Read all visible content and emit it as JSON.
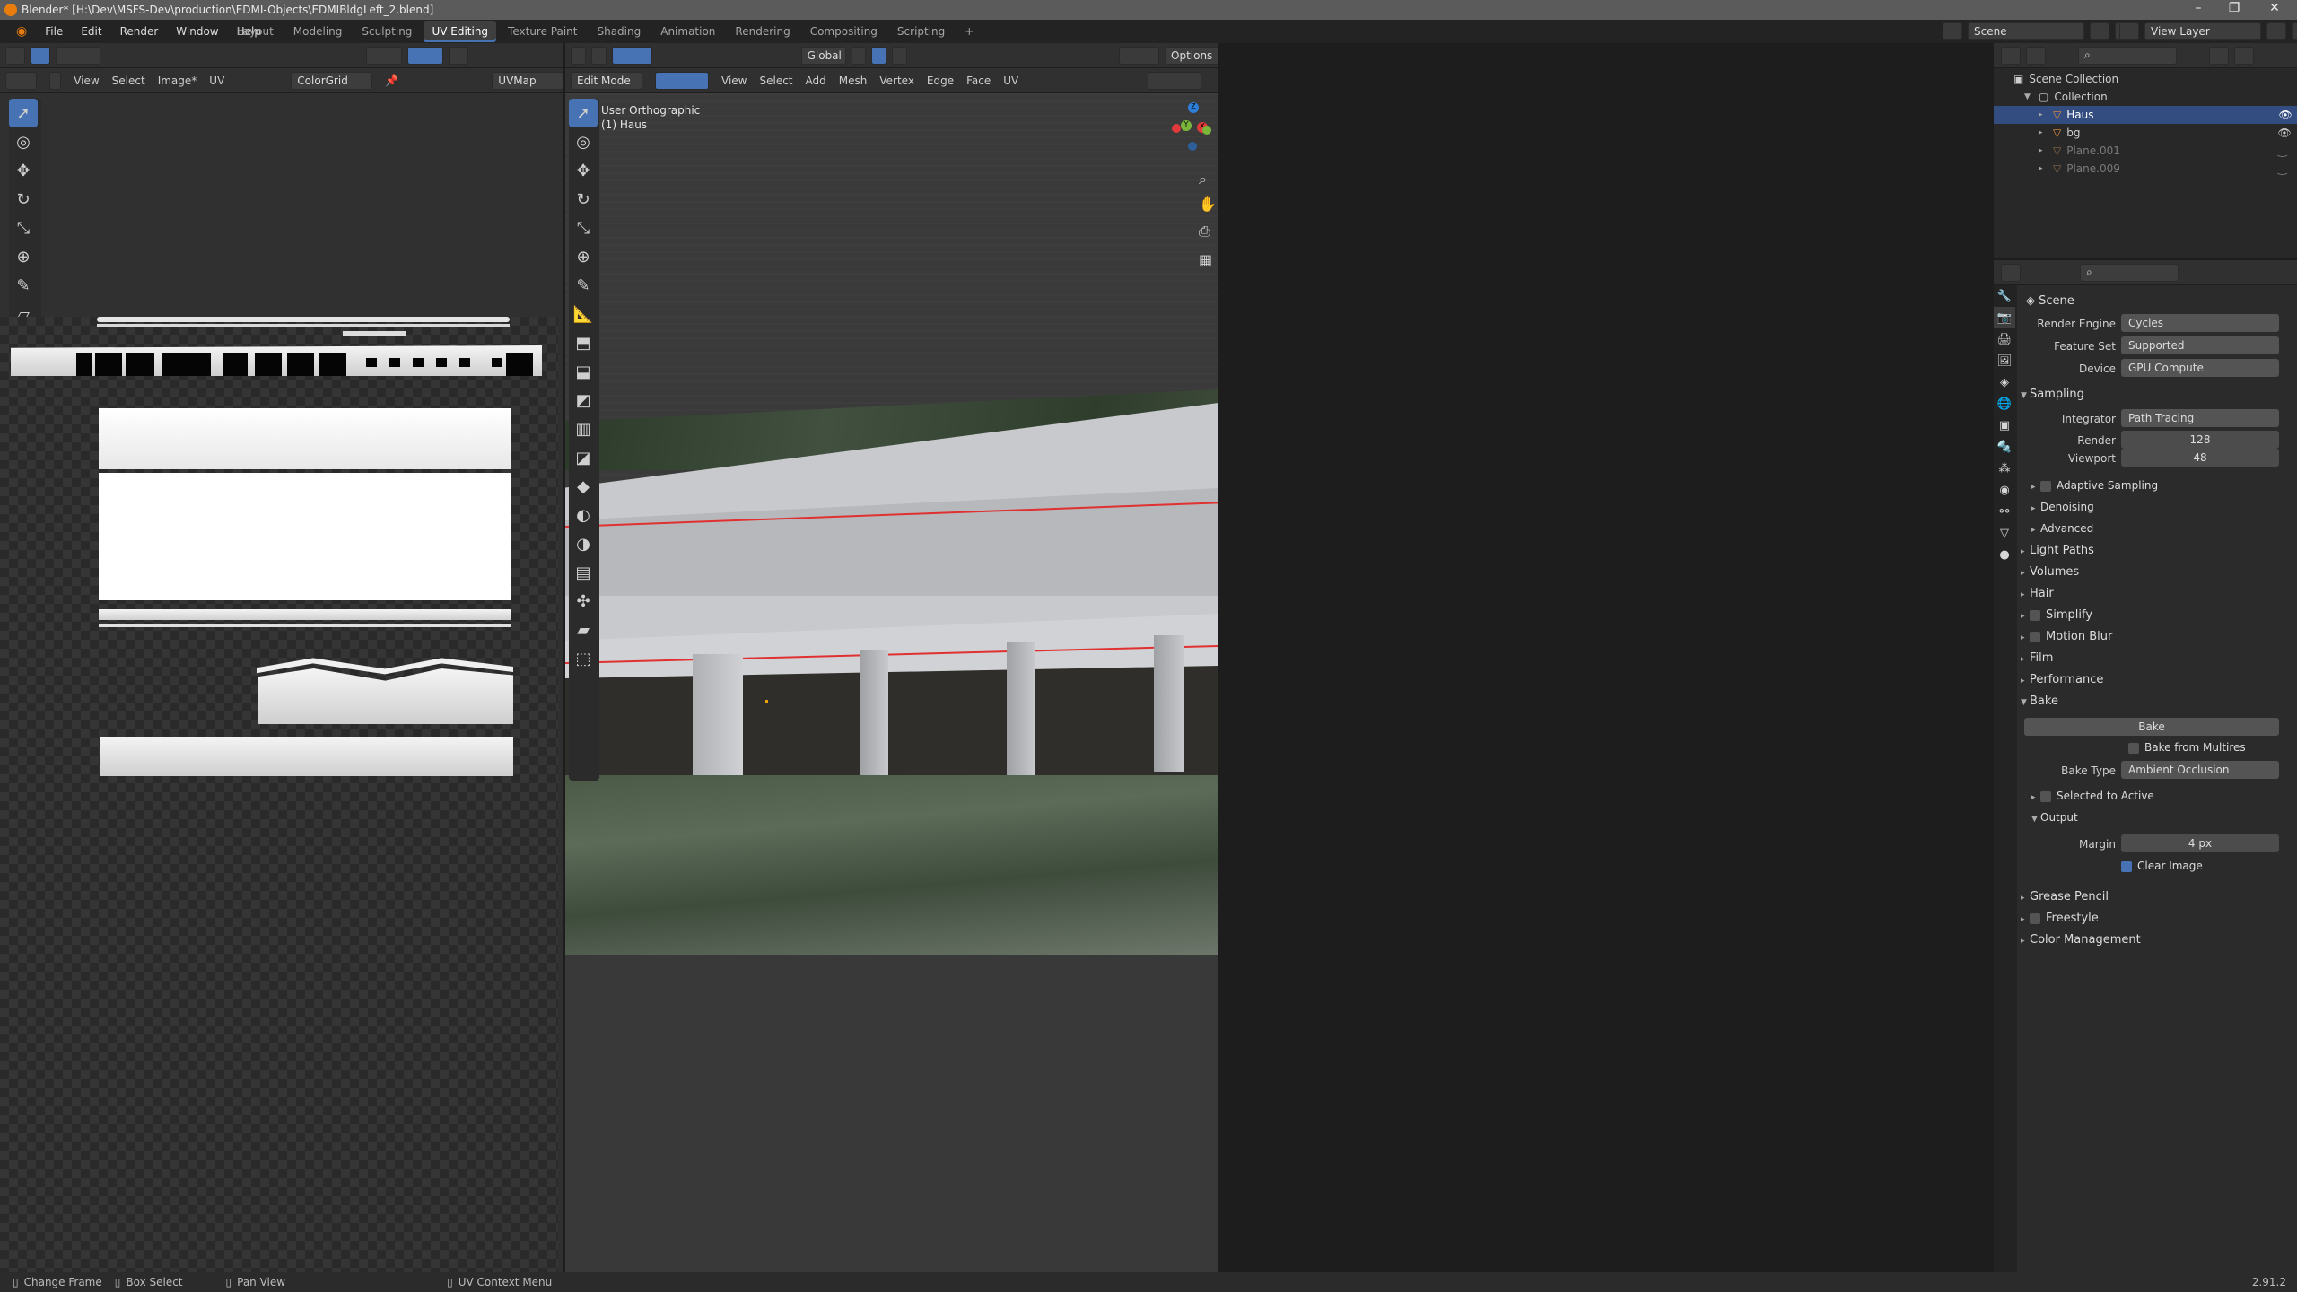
{
  "window": {
    "title": "Blender* [H:\\Dev\\MSFS-Dev\\production\\EDMI-Objects\\EDMIBldgLeft_2.blend]",
    "minimize": "–",
    "maximize": "❐",
    "close": "✕"
  },
  "menu": [
    "File",
    "Edit",
    "Render",
    "Window",
    "Help"
  ],
  "workspaces": [
    "Layout",
    "Modeling",
    "Sculpting",
    "UV Editing",
    "Texture Paint",
    "Shading",
    "Animation",
    "Rendering",
    "Compositing",
    "Scripting"
  ],
  "active_workspace": "UV Editing",
  "add_workspace": "+",
  "scene": {
    "label": "Scene",
    "view_layer": "View Layer"
  },
  "uv_editor": {
    "menus": [
      "View",
      "Select",
      "Image*",
      "UV"
    ],
    "image_name": "ColorGrid",
    "uvmap": "UVMap"
  },
  "viewport": {
    "mode": "Edit Mode",
    "menus": [
      "View",
      "Select",
      "Add",
      "Mesh",
      "Vertex",
      "Edge",
      "Face",
      "UV"
    ],
    "orientation": "Global",
    "options": "Options",
    "overlay_title": "User Orthographic",
    "overlay_object": "(1) Haus",
    "axes": {
      "x": "X",
      "y": "Y",
      "z": "Z"
    }
  },
  "outliner": {
    "root": "Scene Collection",
    "collection": "Collection",
    "items": [
      {
        "name": "Haus",
        "selected": true
      },
      {
        "name": "bg",
        "selected": false
      },
      {
        "name": "Plane.001",
        "selected": false
      },
      {
        "name": "Plane.009",
        "selected": false
      }
    ]
  },
  "properties": {
    "context": "Scene",
    "render_engine": {
      "label": "Render Engine",
      "value": "Cycles"
    },
    "feature_set": {
      "label": "Feature Set",
      "value": "Supported"
    },
    "device": {
      "label": "Device",
      "value": "GPU Compute"
    },
    "sampling": {
      "title": "Sampling",
      "integrator": {
        "label": "Integrator",
        "value": "Path Tracing"
      },
      "render": {
        "label": "Render",
        "value": "128"
      },
      "viewport": {
        "label": "Viewport",
        "value": "48"
      },
      "sub": [
        "Adaptive Sampling",
        "Denoising",
        "Advanced"
      ]
    },
    "sections": [
      "Light Paths",
      "Volumes",
      "Hair",
      "Simplify",
      "Motion Blur",
      "Film",
      "Performance"
    ],
    "bake": {
      "title": "Bake",
      "button": "Bake",
      "from_multires": "Bake from Multires",
      "type_label": "Bake Type",
      "type_value": "Ambient Occlusion",
      "selected_to_active": "Selected to Active",
      "output": "Output",
      "margin_label": "Margin",
      "margin_value": "4 px",
      "clear_image": "Clear Image"
    },
    "bottom_sections": [
      "Grease Pencil",
      "Freestyle",
      "Color Management"
    ]
  },
  "status": {
    "change_frame": "Change Frame",
    "box_select": "Box Select",
    "pan_view": "Pan View",
    "context_menu": "UV Context Menu",
    "version": "2.91.2"
  },
  "colors": {
    "accent": "#4772b3",
    "edge_red": "#e03030",
    "logo": "#e87d0d"
  }
}
